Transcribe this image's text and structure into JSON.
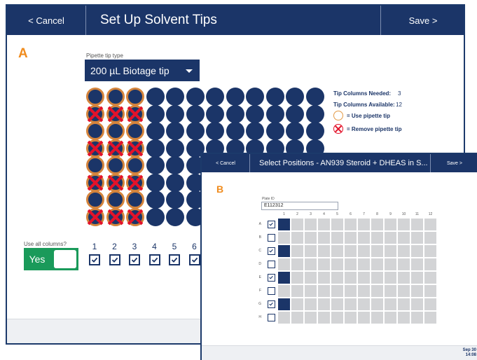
{
  "window_a": {
    "cancel": "< Cancel",
    "title": "Set Up Solvent Tips",
    "save": "Save >",
    "marker": "A",
    "tip_type_label": "Pipette tip type",
    "tip_type_value": "200 µL Biotage tip",
    "tip_columns_needed_label": "Tip Columns Needed:",
    "tip_columns_needed_value": "3",
    "tip_columns_available_label": "Tip Columns Available:",
    "tip_columns_available_value": "12",
    "legend_use": "= Use pipette tip",
    "legend_remove": "= Remove pipette tip",
    "use_all_columns_label": "Use all columns?",
    "use_all_columns_value": "Yes",
    "columns": [
      "1",
      "2",
      "3",
      "4",
      "5",
      "6"
    ],
    "columns_checked": [
      true,
      true,
      true,
      true,
      true,
      true
    ],
    "tip_rows": [
      [
        "use",
        "use",
        "use"
      ],
      [
        "remove",
        "remove",
        "remove"
      ],
      [
        "use",
        "use",
        "use"
      ],
      [
        "remove",
        "remove",
        "remove"
      ],
      [
        "use",
        "use",
        "use"
      ],
      [
        "remove",
        "remove",
        "remove"
      ],
      [
        "use",
        "use",
        "use"
      ],
      [
        "remove",
        "remove",
        "remove"
      ]
    ]
  },
  "window_b": {
    "cancel": "< Cancel",
    "title": "Select Positions - AN939 Steroid + DHEAS in S...",
    "save": "Save >",
    "marker": "B",
    "plate_id_label": "Plate ID",
    "plate_id_value": "E112312",
    "column_labels": [
      "1",
      "2",
      "3",
      "4",
      "5",
      "6",
      "7",
      "8",
      "9",
      "10",
      "11",
      "12"
    ],
    "row_labels": [
      "A",
      "B",
      "C",
      "D",
      "E",
      "F",
      "G",
      "H"
    ],
    "rows_checked": [
      true,
      false,
      true,
      false,
      true,
      false,
      true,
      false
    ],
    "date": "Sep 30",
    "time": "14:08"
  },
  "colors": {
    "navy": "#1b3568",
    "orange": "#f08c1e",
    "red": "#e3122a",
    "green": "#1a9a5a"
  }
}
